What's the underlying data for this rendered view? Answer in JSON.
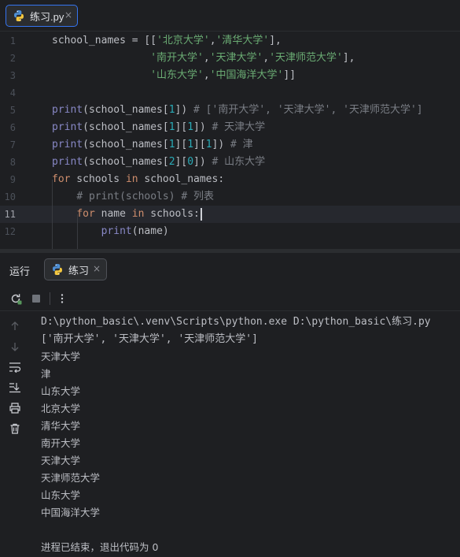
{
  "editor": {
    "tab": {
      "filename": "练习.py",
      "close": "×"
    },
    "line_numbers": [
      "1",
      "2",
      "3",
      "4",
      "5",
      "6",
      "7",
      "8",
      "9",
      "10",
      "11",
      "12"
    ],
    "current_line": "11"
  },
  "code_lines": [
    [
      {
        "t": "school_names = [[",
        "c": ""
      },
      {
        "t": "'北京大学'",
        "c": "str"
      },
      {
        "t": ",",
        "c": ""
      },
      {
        "t": "'清华大学'",
        "c": "str"
      },
      {
        "t": "],",
        "c": ""
      }
    ],
    [
      {
        "t": "                ",
        "c": ""
      },
      {
        "t": "'南开大学'",
        "c": "str"
      },
      {
        "t": ",",
        "c": ""
      },
      {
        "t": "'天津大学'",
        "c": "str"
      },
      {
        "t": ",",
        "c": ""
      },
      {
        "t": "'天津师范大学'",
        "c": "str"
      },
      {
        "t": "],",
        "c": ""
      }
    ],
    [
      {
        "t": "                ",
        "c": ""
      },
      {
        "t": "'山东大学'",
        "c": "str"
      },
      {
        "t": ",",
        "c": ""
      },
      {
        "t": "'中国海洋大学'",
        "c": "str"
      },
      {
        "t": "]]",
        "c": ""
      }
    ],
    [],
    [
      {
        "t": "print",
        "c": "fn"
      },
      {
        "t": "(school_names[",
        "c": ""
      },
      {
        "t": "1",
        "c": "num"
      },
      {
        "t": "]) ",
        "c": ""
      },
      {
        "t": "# ['南开大学', '天津大学', '天津师范大学']",
        "c": "cmt"
      }
    ],
    [
      {
        "t": "print",
        "c": "fn"
      },
      {
        "t": "(school_names[",
        "c": ""
      },
      {
        "t": "1",
        "c": "num"
      },
      {
        "t": "][",
        "c": ""
      },
      {
        "t": "1",
        "c": "num"
      },
      {
        "t": "]) ",
        "c": ""
      },
      {
        "t": "# 天津大学",
        "c": "cmt"
      }
    ],
    [
      {
        "t": "print",
        "c": "fn"
      },
      {
        "t": "(school_names[",
        "c": ""
      },
      {
        "t": "1",
        "c": "num"
      },
      {
        "t": "][",
        "c": ""
      },
      {
        "t": "1",
        "c": "num"
      },
      {
        "t": "][",
        "c": ""
      },
      {
        "t": "1",
        "c": "num"
      },
      {
        "t": "]) ",
        "c": ""
      },
      {
        "t": "# 津",
        "c": "cmt"
      }
    ],
    [
      {
        "t": "print",
        "c": "fn"
      },
      {
        "t": "(school_names[",
        "c": ""
      },
      {
        "t": "2",
        "c": "num"
      },
      {
        "t": "][",
        "c": ""
      },
      {
        "t": "0",
        "c": "num"
      },
      {
        "t": "]) ",
        "c": ""
      },
      {
        "t": "# 山东大学",
        "c": "cmt"
      }
    ],
    [
      {
        "t": "for",
        "c": "kw"
      },
      {
        "t": " schools ",
        "c": ""
      },
      {
        "t": "in",
        "c": "kw"
      },
      {
        "t": " school_names:",
        "c": ""
      }
    ],
    [
      {
        "t": "    ",
        "c": ""
      },
      {
        "t": "# print(schools) # 列表",
        "c": "cmt"
      }
    ],
    [
      {
        "t": "    ",
        "c": ""
      },
      {
        "t": "for",
        "c": "kw"
      },
      {
        "t": " name ",
        "c": ""
      },
      {
        "t": "in",
        "c": "kw"
      },
      {
        "t": " schools:",
        "c": ""
      }
    ],
    [
      {
        "t": "        ",
        "c": ""
      },
      {
        "t": "print",
        "c": "fn"
      },
      {
        "t": "(name)",
        "c": ""
      }
    ]
  ],
  "run": {
    "title": "运行",
    "tab_label": "练习",
    "tab_close": "×",
    "toolbar_icons": [
      "rerun-icon",
      "stop-icon",
      "more-icon"
    ],
    "side_icons": [
      "scroll-up-icon",
      "scroll-down-icon",
      "soft-wrap-icon",
      "scroll-to-end-icon",
      "print-icon",
      "trash-icon"
    ]
  },
  "console": {
    "lines": [
      "D:\\python_basic\\.venv\\Scripts\\python.exe D:\\python_basic\\练习.py",
      "['南开大学', '天津大学', '天津师范大学']",
      "天津大学",
      "津",
      "山东大学",
      "北京大学",
      "清华大学",
      "南开大学",
      "天津大学",
      "天津师范大学",
      "山东大学",
      "中国海洋大学",
      "",
      "进程已结束，退出代码为 0"
    ]
  },
  "colors": {
    "background": "#1e1f22",
    "keyword": "#cf8e6d",
    "builtin": "#8888c6",
    "string": "#6aab73",
    "number": "#2aacb8",
    "comment": "#7a7e85",
    "accent": "#3574f0"
  }
}
